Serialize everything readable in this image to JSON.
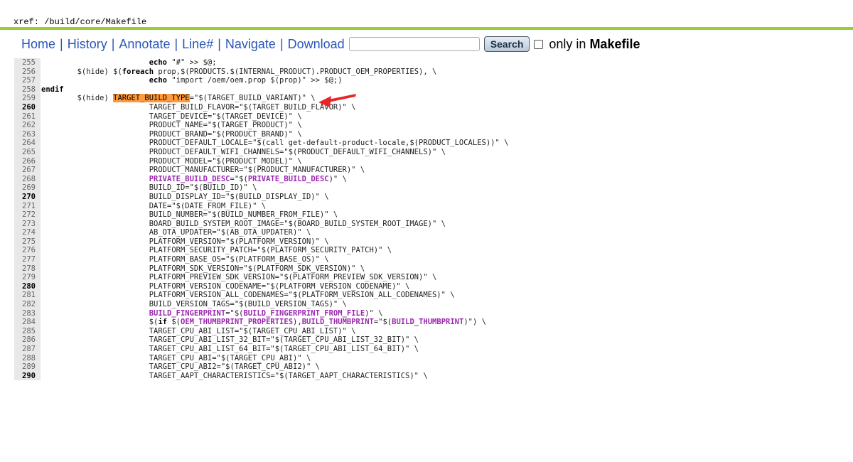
{
  "xref": {
    "label": "xref:",
    "path": "/build/core/Makefile"
  },
  "nav": {
    "home": "Home",
    "history": "History",
    "annotate": "Annotate",
    "line": "Line#",
    "navigate": "Navigate",
    "download": "Download",
    "search_value": "",
    "search_button": "Search",
    "only_in": "only in",
    "file": "Makefile"
  },
  "code": [
    {
      "n": "255",
      "t": "\t\t\techo \"#\" >> $@;"
    },
    {
      "n": "256",
      "t": "\t$(hide) $(foreach prop,$(PRODUCTS.$(INTERNAL_PRODUCT).PRODUCT_OEM_PROPERTIES), \\"
    },
    {
      "n": "257",
      "t": "\t\t\techo \"import /oem/oem.prop $(prop)\" >> $@;)"
    },
    {
      "n": "258",
      "t": "endif"
    },
    {
      "n": "259",
      "t": "\t$(hide) TARGET_BUILD_TYPE=\"$(TARGET_BUILD_VARIANT)\" \\"
    },
    {
      "n": "260",
      "t": "\t\t\tTARGET_BUILD_FLAVOR=\"$(TARGET_BUILD_FLAVOR)\" \\"
    },
    {
      "n": "261",
      "t": "\t\t\tTARGET_DEVICE=\"$(TARGET_DEVICE)\" \\"
    },
    {
      "n": "262",
      "t": "\t\t\tPRODUCT_NAME=\"$(TARGET_PRODUCT)\" \\"
    },
    {
      "n": "263",
      "t": "\t\t\tPRODUCT_BRAND=\"$(PRODUCT_BRAND)\" \\"
    },
    {
      "n": "264",
      "t": "\t\t\tPRODUCT_DEFAULT_LOCALE=\"$(call get-default-product-locale,$(PRODUCT_LOCALES))\" \\"
    },
    {
      "n": "265",
      "t": "\t\t\tPRODUCT_DEFAULT_WIFI_CHANNELS=\"$(PRODUCT_DEFAULT_WIFI_CHANNELS)\" \\"
    },
    {
      "n": "266",
      "t": "\t\t\tPRODUCT_MODEL=\"$(PRODUCT_MODEL)\" \\"
    },
    {
      "n": "267",
      "t": "\t\t\tPRODUCT_MANUFACTURER=\"$(PRODUCT_MANUFACTURER)\" \\"
    },
    {
      "n": "268",
      "t": "\t\t\tPRIVATE_BUILD_DESC=\"$(PRIVATE_BUILD_DESC)\" \\"
    },
    {
      "n": "269",
      "t": "\t\t\tBUILD_ID=\"$(BUILD_ID)\" \\"
    },
    {
      "n": "270",
      "t": "\t\t\tBUILD_DISPLAY_ID=\"$(BUILD_DISPLAY_ID)\" \\"
    },
    {
      "n": "271",
      "t": "\t\t\tDATE=\"$(DATE_FROM_FILE)\" \\"
    },
    {
      "n": "272",
      "t": "\t\t\tBUILD_NUMBER=\"$(BUILD_NUMBER_FROM_FILE)\" \\"
    },
    {
      "n": "273",
      "t": "\t\t\tBOARD_BUILD_SYSTEM_ROOT_IMAGE=\"$(BOARD_BUILD_SYSTEM_ROOT_IMAGE)\" \\"
    },
    {
      "n": "274",
      "t": "\t\t\tAB_OTA_UPDATER=\"$(AB_OTA_UPDATER)\" \\"
    },
    {
      "n": "275",
      "t": "\t\t\tPLATFORM_VERSION=\"$(PLATFORM_VERSION)\" \\"
    },
    {
      "n": "276",
      "t": "\t\t\tPLATFORM_SECURITY_PATCH=\"$(PLATFORM_SECURITY_PATCH)\" \\"
    },
    {
      "n": "277",
      "t": "\t\t\tPLATFORM_BASE_OS=\"$(PLATFORM_BASE_OS)\" \\"
    },
    {
      "n": "278",
      "t": "\t\t\tPLATFORM_SDK_VERSION=\"$(PLATFORM_SDK_VERSION)\" \\"
    },
    {
      "n": "279",
      "t": "\t\t\tPLATFORM_PREVIEW_SDK_VERSION=\"$(PLATFORM_PREVIEW_SDK_VERSION)\" \\"
    },
    {
      "n": "280",
      "t": "\t\t\tPLATFORM_VERSION_CODENAME=\"$(PLATFORM_VERSION_CODENAME)\" \\"
    },
    {
      "n": "281",
      "t": "\t\t\tPLATFORM_VERSION_ALL_CODENAMES=\"$(PLATFORM_VERSION_ALL_CODENAMES)\" \\"
    },
    {
      "n": "282",
      "t": "\t\t\tBUILD_VERSION_TAGS=\"$(BUILD_VERSION_TAGS)\" \\"
    },
    {
      "n": "283",
      "t": "\t\t\tBUILD_FINGERPRINT=\"$(BUILD_FINGERPRINT_FROM_FILE)\" \\"
    },
    {
      "n": "284",
      "t": "\t\t\t$(if $(OEM_THUMBPRINT_PROPERTIES),BUILD_THUMBPRINT=\"$(BUILD_THUMBPRINT)\") \\"
    },
    {
      "n": "285",
      "t": "\t\t\tTARGET_CPU_ABI_LIST=\"$(TARGET_CPU_ABI_LIST)\" \\"
    },
    {
      "n": "286",
      "t": "\t\t\tTARGET_CPU_ABI_LIST_32_BIT=\"$(TARGET_CPU_ABI_LIST_32_BIT)\" \\"
    },
    {
      "n": "287",
      "t": "\t\t\tTARGET_CPU_ABI_LIST_64_BIT=\"$(TARGET_CPU_ABI_LIST_64_BIT)\" \\"
    },
    {
      "n": "288",
      "t": "\t\t\tTARGET_CPU_ABI=\"$(TARGET_CPU_ABI)\" \\"
    },
    {
      "n": "289",
      "t": "\t\t\tTARGET_CPU_ABI2=\"$(TARGET_CPU_ABI2)\" \\"
    },
    {
      "n": "290",
      "t": "\t\t\tTARGET_AAPT_CHARACTERISTICS=\"$(TARGET_AAPT_CHARACTERISTICS)\" \\"
    }
  ],
  "bold_lines": [
    "260",
    "270",
    "280",
    "290"
  ],
  "highlight_term": "TARGET_BUILD_TYPE",
  "colors": {
    "accent_bar": "#9acd32",
    "link": "#2a56b8",
    "highlight": "#ff9a3c",
    "arrow": "#e8262a",
    "purple": "#9c27b0"
  }
}
